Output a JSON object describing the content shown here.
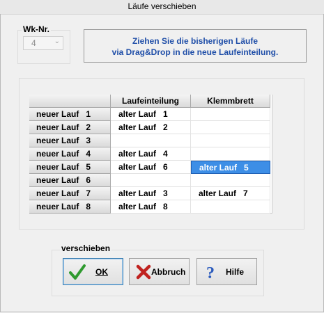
{
  "window": {
    "title": "Läufe verschieben"
  },
  "wk": {
    "label": "Wk-Nr.",
    "value": "4"
  },
  "info": {
    "line1": "Ziehen Sie die bisherigen Läufe",
    "line2": "via Drag&Drop in die neue Laufeinteilung."
  },
  "grid": {
    "headers": [
      "",
      "Laufeinteilung",
      "Klemmbrett"
    ],
    "rows": [
      {
        "label": "neuer Lauf   1",
        "lauf": "alter Lauf   1",
        "klemm": ""
      },
      {
        "label": "neuer Lauf   2",
        "lauf": "alter Lauf   2",
        "klemm": ""
      },
      {
        "label": "neuer Lauf   3",
        "lauf": "",
        "klemm": ""
      },
      {
        "label": "neuer Lauf   4",
        "lauf": "alter Lauf   4",
        "klemm": ""
      },
      {
        "label": "neuer Lauf   5",
        "lauf": "alter Lauf   6",
        "klemm": "alter Lauf   5"
      },
      {
        "label": "neuer Lauf   6",
        "lauf": "",
        "klemm": ""
      },
      {
        "label": "neuer Lauf   7",
        "lauf": "alter Lauf   3",
        "klemm": "alter Lauf   7"
      },
      {
        "label": "neuer Lauf   8",
        "lauf": "alter Lauf   8",
        "klemm": ""
      }
    ],
    "selected_cell": "alter Lauf   5"
  },
  "actions": {
    "group_label": "verschieben",
    "ok": "OK",
    "abbruch": "Abbruch",
    "hilfe": "Hilfe"
  },
  "icons": {
    "ok": "checkmark-icon",
    "abbruch": "x-icon",
    "hilfe": "question-icon"
  },
  "colors": {
    "info_text": "#1f4ea8",
    "selection": "#3d8ee6"
  }
}
